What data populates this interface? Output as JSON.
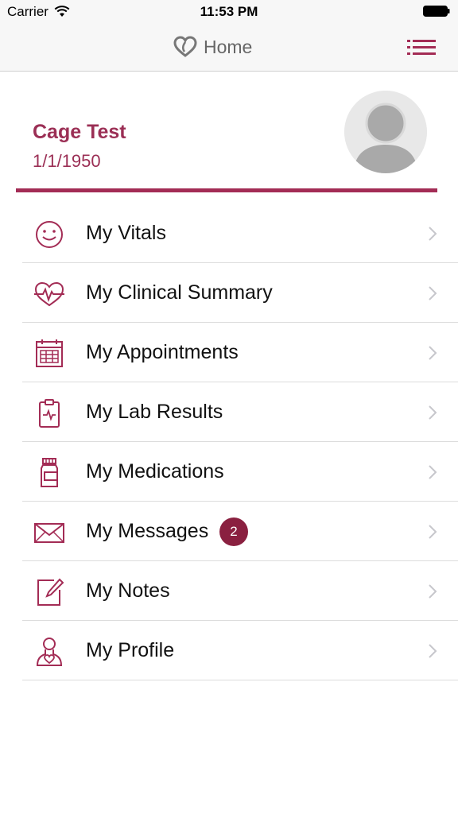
{
  "status_bar": {
    "carrier": "Carrier",
    "time": "11:53 PM"
  },
  "nav": {
    "title": "Home",
    "logo_icon": "heart-logo-icon",
    "menu_icon": "list-menu-icon"
  },
  "profile": {
    "name": "Cage Test",
    "dob": "1/1/1950",
    "avatar_icon": "avatar-placeholder-icon"
  },
  "menu": {
    "items": [
      {
        "label": "My Vitals",
        "icon": "smiley-icon"
      },
      {
        "label": "My Clinical Summary",
        "icon": "heart-pulse-icon"
      },
      {
        "label": "My Appointments",
        "icon": "calendar-icon"
      },
      {
        "label": "My Lab Results",
        "icon": "clipboard-icon"
      },
      {
        "label": "My Medications",
        "icon": "pill-bottle-icon"
      },
      {
        "label": "My Messages",
        "icon": "envelope-icon",
        "badge": "2"
      },
      {
        "label": "My Notes",
        "icon": "notepad-icon"
      },
      {
        "label": "My Profile",
        "icon": "person-heart-icon"
      }
    ]
  },
  "colors": {
    "accent": "#a32c55",
    "badge": "#8a2040",
    "bar_background": "#f7f7f7"
  }
}
